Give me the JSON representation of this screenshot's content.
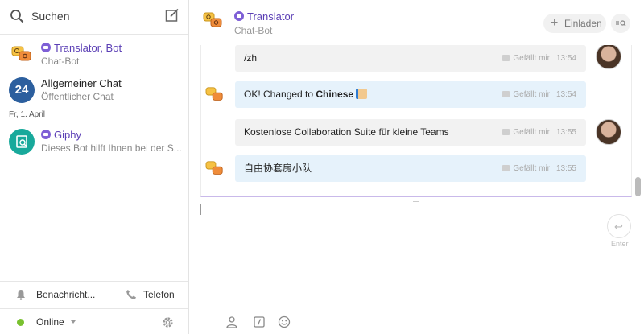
{
  "sidebar": {
    "search_placeholder": "Suchen",
    "chats": [
      {
        "name": "Translator, Bot",
        "subtitle": "Chat-Bot",
        "is_bot": true,
        "avatar": "translator-bot-avatar"
      },
      {
        "name": "Allgemeiner Chat",
        "subtitle": "Öffentlicher Chat",
        "is_bot": false,
        "avatar_text": "24"
      },
      {
        "name": "Giphy",
        "subtitle": "Dieses Bot hilft Ihnen bei der S...",
        "is_bot": true,
        "avatar": "giphy-avatar"
      }
    ],
    "date_separator": "Fr, 1. April",
    "notifications_label": "Benachricht...",
    "phone_label": "Telefon",
    "status_label": "Online"
  },
  "header": {
    "title": "Translator",
    "subtitle": "Chat-Bot",
    "invite_label": "Einladen"
  },
  "messages": [
    {
      "sender": "me",
      "text": "/zh",
      "like_label": "Gefällt mir",
      "time": "13:54"
    },
    {
      "sender": "bot",
      "text_prefix": "OK! Changed to ",
      "text_bold": "Chinese",
      "like_label": "Gefällt mir",
      "time": "13:54"
    },
    {
      "sender": "me",
      "text": "Kostenlose Collaboration Suite für kleine Teams",
      "like_label": "Gefällt mir",
      "time": "13:55"
    },
    {
      "sender": "bot",
      "text": "自由协套房小队",
      "like_label": "Gefällt mir",
      "time": "13:55"
    }
  ],
  "composer": {
    "enter_label": "Enter"
  },
  "colors": {
    "bot_name": "#5b3fb5",
    "bot_bubble": "#e6f2fb",
    "my_bubble": "#f2f2f2",
    "online": "#79c12f"
  }
}
